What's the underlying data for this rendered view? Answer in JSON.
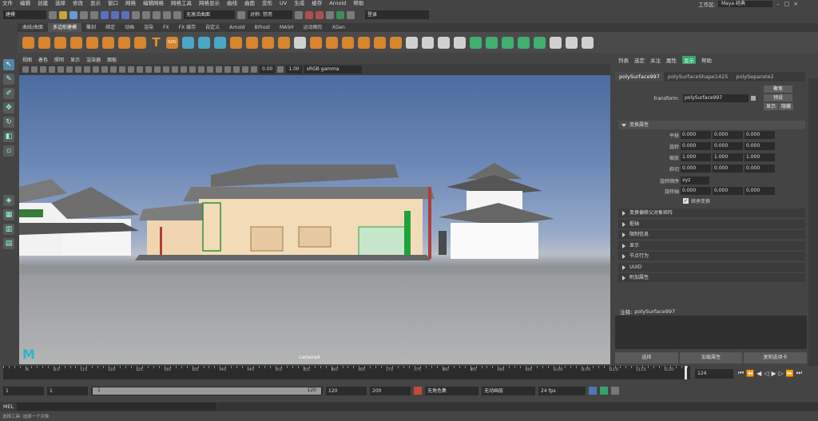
{
  "menubar": {
    "items": [
      "文件",
      "编辑",
      "创建",
      "选择",
      "修改",
      "显示",
      "窗口",
      "网格",
      "编辑网格",
      "网格工具",
      "网格显示",
      "曲线",
      "曲面",
      "变形",
      "UV",
      "生成",
      "缓存",
      "Arnold",
      "帮助"
    ]
  },
  "workspace": {
    "label": "工作区:",
    "value": "Maya 经典"
  },
  "statusline": {
    "mode": "建模",
    "soft_select": "无激活曲面",
    "symmetry": "对称: 禁用",
    "login": "登录"
  },
  "shelf": {
    "tabs": [
      "曲线/曲面",
      "多边形建模",
      "雕刻",
      "绑定",
      "动画",
      "渲染",
      "FX",
      "FX 缓存",
      "自定义",
      "Arnold",
      "Bifrost",
      "MASH",
      "运动图形",
      "XGen"
    ],
    "active": 1,
    "svg_label": "SVG"
  },
  "viewport": {
    "menu": [
      "视图",
      "着色",
      "照明",
      "显示",
      "渲染器",
      "面板"
    ],
    "exposure": "0.00",
    "gamma": "1.00",
    "colorspace": "sRGB gamma",
    "camera": "camera4"
  },
  "attribute_editor": {
    "tabs": [
      "列表",
      "选定",
      "关注",
      "属性",
      "显示",
      "帮助"
    ],
    "active_tab": 4,
    "node_tabs": [
      "polySurface997",
      "polySurfaceShape1425",
      "polySeparate2"
    ],
    "transform_label": "transform:",
    "transform_value": "polySurface997",
    "btn_focus": "聚焦",
    "btn_preset": "预设",
    "btn_show": "显示",
    "btn_hide": "隐藏",
    "section_transform": "变换属性",
    "rows": [
      {
        "label": "平移",
        "values": [
          "0.000",
          "0.000",
          "0.000"
        ]
      },
      {
        "label": "旋转",
        "values": [
          "0.000",
          "0.000",
          "0.000"
        ]
      },
      {
        "label": "缩放",
        "values": [
          "1.000",
          "1.000",
          "1.000"
        ]
      },
      {
        "label": "斜切",
        "values": [
          "0.000",
          "0.000",
          "0.000"
        ]
      }
    ],
    "rotate_order_label": "旋转顺序",
    "rotate_order_value": "xyz",
    "rotate_axis_label": "旋转轴",
    "rotate_axis_values": [
      "0.000",
      "0.000",
      "0.000"
    ],
    "inherit_label": "继承变换",
    "sections": [
      "变换偏移父对象矩阵",
      "枢轴",
      "限制信息",
      "显示",
      "节点行为",
      "UUID",
      "附加属性"
    ],
    "notes_label": "注释:",
    "notes_value": "polySurface997",
    "bottom_buttons": [
      "选择",
      "加载属性",
      "复制选项卡"
    ]
  },
  "timeline": {
    "ticks": [
      "5",
      "10",
      "15",
      "20",
      "25",
      "30",
      "35",
      "40",
      "45",
      "50",
      "55",
      "60",
      "65",
      "70",
      "75",
      "80",
      "85",
      "90",
      "95",
      "100",
      "105",
      "110",
      "115",
      "120"
    ],
    "current_frame": "124"
  },
  "range": {
    "start": "1",
    "start2": "1",
    "slider_start": "1",
    "slider_end": "120",
    "end": "120",
    "end2": "200",
    "char_set": "无角色集",
    "anim_layer": "无动画层",
    "fps": "24 fps"
  },
  "cmdline": {
    "label": "MEL"
  },
  "helpline": {
    "text": "选择工具: 选择一个对象"
  }
}
